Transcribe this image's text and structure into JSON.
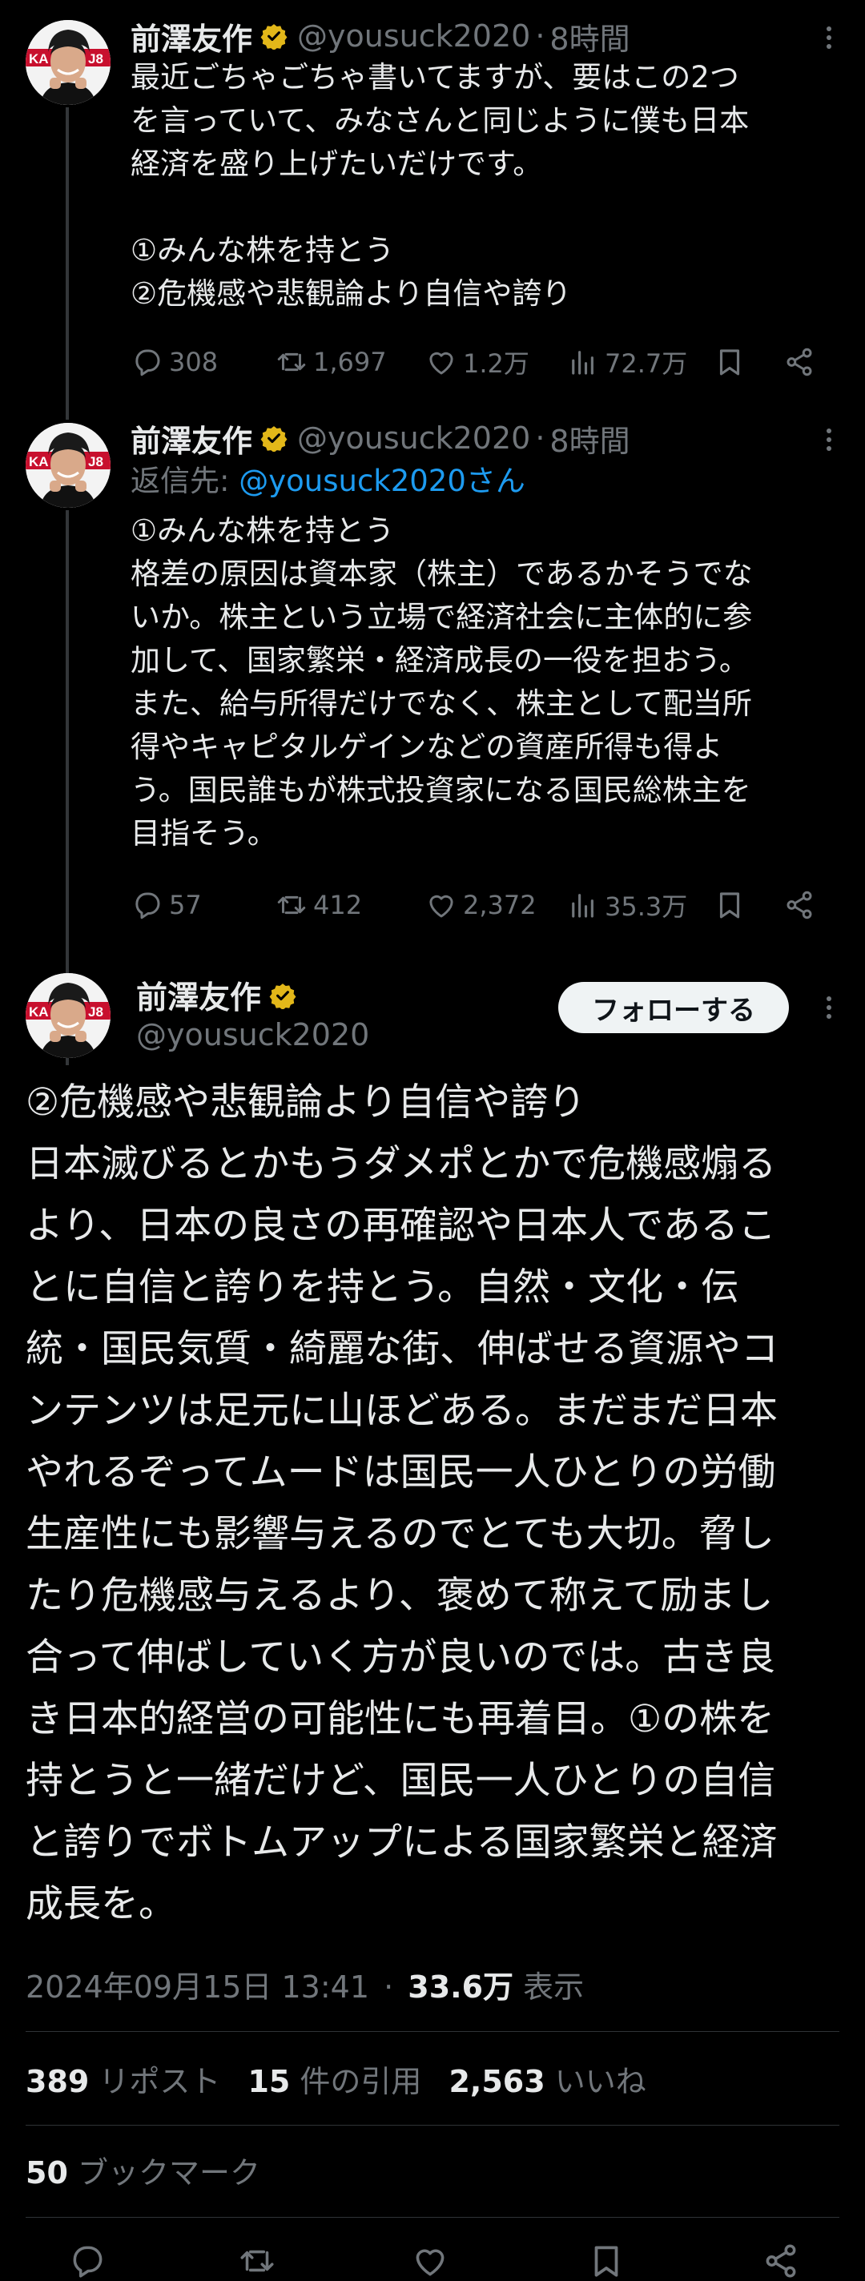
{
  "tweets": [
    {
      "author": "前澤友作",
      "handle": "@yousuck2020",
      "dot": "·",
      "time": "8時間",
      "text": "最近ごちゃごちゃ書いてますが、要はこの2つ\nを言っていて、みなさんと同じように僕も日本\n経済を盛り上げたいだけです。\n\n①みんな株を持とう\n②危機感や悲観論より自信や誇り",
      "replies": "308",
      "reposts": "1,697",
      "likes": "1.2万",
      "views": "72.7万"
    },
    {
      "author": "前澤友作",
      "handle": "@yousuck2020",
      "dot": "·",
      "time": "8時間",
      "reply_to_label": "返信先: ",
      "reply_to_mention": "@yousuck2020さん",
      "text": "①みんな株を持とう\n格差の原因は資本家（株主）であるかそうでな\nいか。株主という立場で経済社会に主体的に参\n加して、国家繁栄・経済成長の一役を担おう。\nまた、給与所得だけでなく、株主として配当所\n得やキャピタルゲインなどの資産所得も得よ\nう。国民誰もが株式投資家になる国民総株主を\n目指そう。",
      "replies": "57",
      "reposts": "412",
      "likes": "2,372",
      "views": "35.3万"
    }
  ],
  "main": {
    "author": "前澤友作",
    "handle": "@yousuck2020",
    "follow_label": "フォローする",
    "text": "②危機感や悲観論より自信や誇り\n日本滅びるとかもうダメポとかで危機感煽る\nより、日本の良さの再確認や日本人であるこ\nとに自信と誇りを持とう。自然・文化・伝\n統・国民気質・綺麗な街、伸ばせる資源やコ\nンテンツは足元に山ほどある。まだまだ日本\nやれるぞってムードは国民一人ひとりの労働\n生産性にも影響与えるのでとても大切。脅し\nたり危機感与えるより、褒めて称えて励まし\n合って伸ばしていく方が良いのでは。古き良\nき日本的経営の可能性にも再着目。①の株を\n持とうと一緒だけど、国民一人ひとりの自信\nと誇りでボトムアップによる国家繁栄と経済\n成長を。",
    "timestamp": "2024年09月15日 13:41",
    "dot": "·",
    "views_count": "33.6万",
    "views_label": "表示",
    "reposts_count": "389",
    "reposts_label": "リポスト",
    "quotes_count": "15",
    "quotes_label": "件の引用",
    "likes_count": "2,563",
    "likes_label": "いいね",
    "bookmarks_count": "50",
    "bookmarks_label": "ブックマーク"
  },
  "colors": {
    "background": "#000000",
    "text": "#e7e9ea",
    "secondary": "#71767b",
    "link": "#1d9bf0",
    "verified_badge": "#e2b719"
  }
}
